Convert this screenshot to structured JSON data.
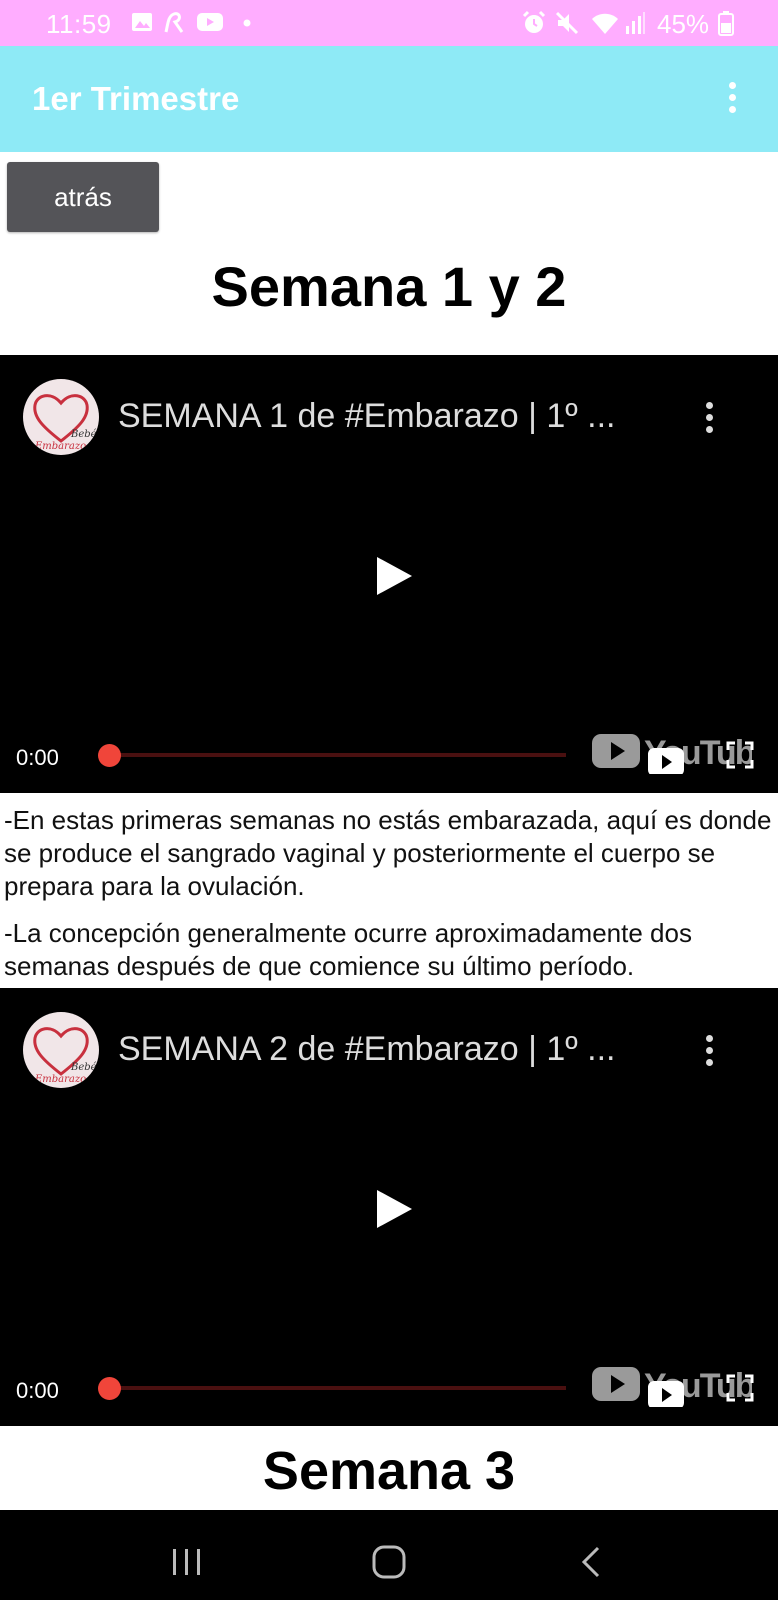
{
  "status_bar": {
    "time": "11:59",
    "battery": "45%",
    "icons": [
      "gallery-icon",
      "r-app-icon",
      "youtube-notif-icon",
      "dot-icon",
      "alarm-icon",
      "mute-icon",
      "wifi-icon",
      "signal-icon",
      "battery-icon"
    ]
  },
  "app_bar": {
    "title": "1er Trimestre",
    "menu_icon": "more-vert-icon"
  },
  "back_button": {
    "label": "atrás"
  },
  "sections": [
    {
      "title": "Semana 1 y 2"
    },
    {
      "title": "Semana 3"
    }
  ],
  "videos": [
    {
      "title": "SEMANA 1 de #Embarazo | 1º ...",
      "time": "0:00",
      "channel_logo_text": "Bebés Embarazo",
      "progress": 0
    },
    {
      "title": "SEMANA 2 de #Embarazo | 1º ...",
      "time": "0:00",
      "channel_logo_text": "Bebés Embarazo",
      "progress": 0
    }
  ],
  "paragraphs": [
    "-En estas primeras semanas no estás embarazada, aquí es donde se produce el sangrado vaginal y posteriormente el cuerpo se prepara para la ovulación.",
    "-La concepción generalmente ocurre aproximadamente dos semanas después de que comience su último período."
  ],
  "colors": {
    "status_bar": "#ffadff",
    "app_bar": "#8eeaf6",
    "button": "#545458",
    "progress": "#f0453a"
  }
}
